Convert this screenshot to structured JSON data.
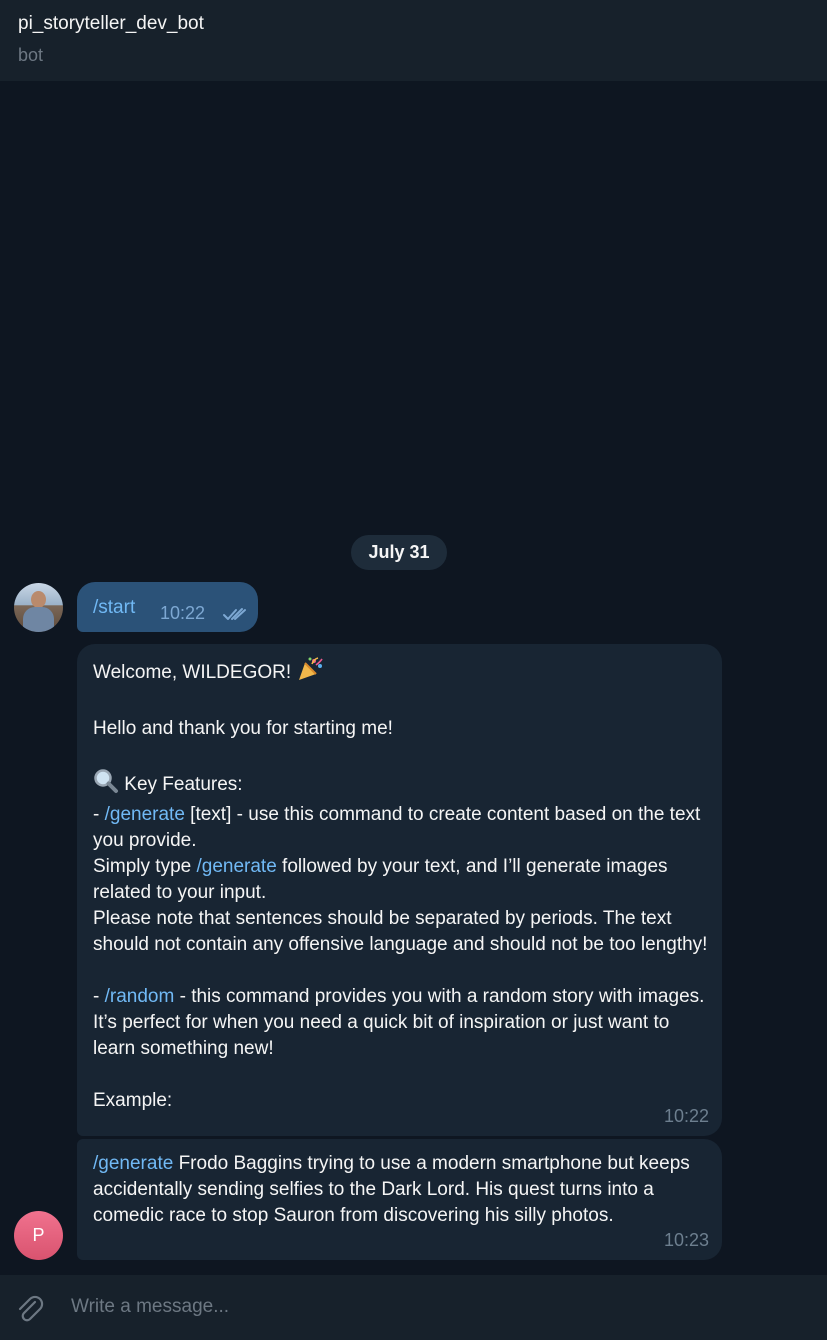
{
  "header": {
    "title": "pi_storyteller_dev_bot",
    "subtitle": "bot"
  },
  "chat": {
    "date": "July 31",
    "outgoing": {
      "text": "/start",
      "time": "10:22",
      "status_icon": "double-check-icon"
    },
    "incoming": [
      {
        "time": "10:22",
        "parts": [
          {
            "t": "Welcome, WILDEGOR! "
          },
          {
            "emoji": "party-popper"
          },
          {
            "t": "\n\nHello and thank you for starting me!\n\n"
          },
          {
            "emoji": "magnifier"
          },
          {
            "t": " Key Features:\n- "
          },
          {
            "link": "/generate"
          },
          {
            "t": " [text] - use this command to create content based on the text you provide.\nSimply type "
          },
          {
            "link": "/generate"
          },
          {
            "t": " followed by your text, and I’ll generate images related to your input.\nPlease note that sentences should be separated by periods. The text should not contain any offensive language and should not be too lengthy!\n\n- "
          },
          {
            "link": "/random"
          },
          {
            "t": " - this command provides you with a random story with images. It’s perfect for when you need a quick bit of inspiration or just want to learn something new!\n\nExample:"
          }
        ]
      },
      {
        "time": "10:23",
        "parts": [
          {
            "link": "/generate"
          },
          {
            "t": " Frodo Baggins trying to use a modern smartphone but keeps accidentally sending selfies to the Dark Lord. His quest turns into a comedic race to stop Sauron from discovering his silly photos."
          }
        ]
      }
    ],
    "sender_avatar_letter": "P"
  },
  "composer": {
    "placeholder": "Write a message...",
    "attach_icon": "paperclip-icon"
  },
  "colors": {
    "background": "#0e1621",
    "panel": "#17212b",
    "incoming_bubble": "#182533",
    "outgoing_bubble": "#2b5278",
    "link": "#71b9f5"
  }
}
